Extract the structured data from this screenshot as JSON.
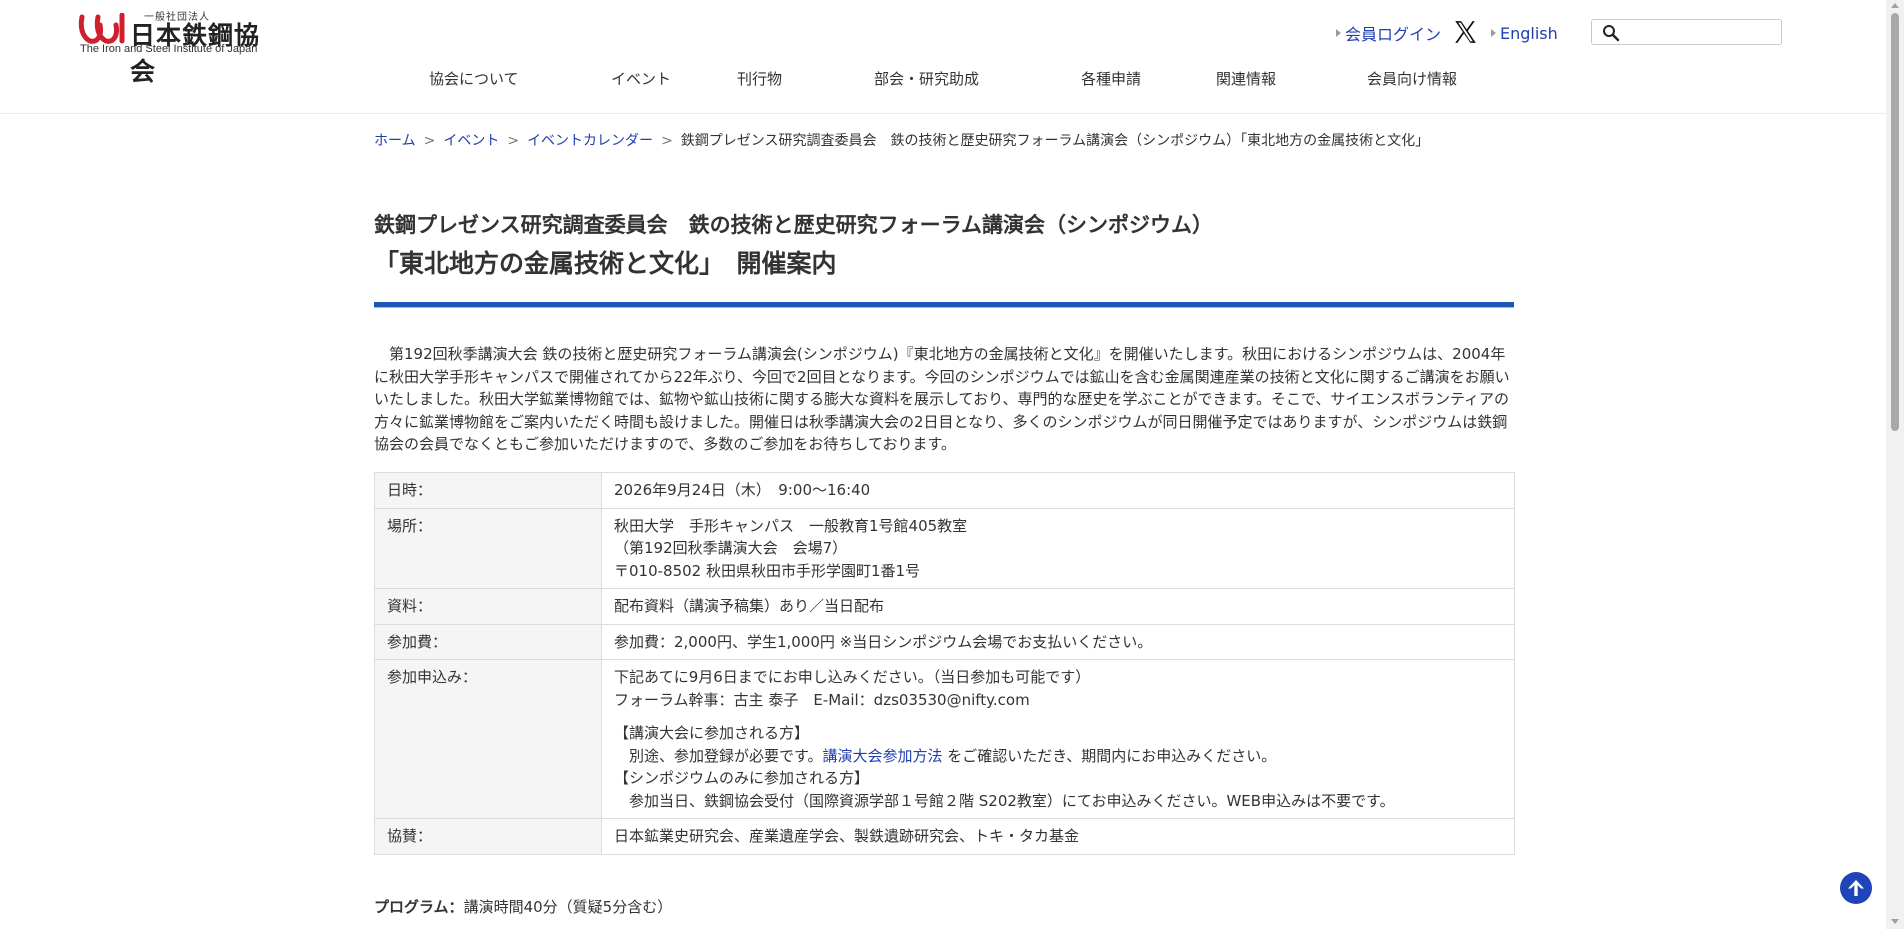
{
  "header": {
    "logo": {
      "small_text": "一般社団法人",
      "name": "日本鉄鋼協会",
      "english": "The Iron and Steel Institute of Japan",
      "mark_color": "#d0202e"
    },
    "util": {
      "login_label": "会員ログイン",
      "x_icon": "x-logo-icon",
      "english_label": "English"
    },
    "search": {
      "value": "",
      "icon": "search-icon"
    },
    "nav": [
      "協会について",
      "イベント",
      "刊行物",
      "部会・研究助成",
      "各種申請",
      "関連情報",
      "会員向け情報"
    ]
  },
  "breadcrumb": {
    "links": [
      "ホーム",
      "イベント",
      "イベントカレンダー"
    ],
    "separator": ">",
    "current": "鉄鋼プレゼンス研究調査委員会　鉄の技術と歴史研究フォーラム講演会（シンポジウム）「東北地方の金属技術と文化」"
  },
  "page": {
    "title_line1": "鉄鋼プレゼンス研究調査委員会　鉄の技術と歴史研究フォーラム講演会（シンポジウム）",
    "title_line2": "「東北地方の金属技術と文化」　開催案内",
    "accent_color": "#1d56b5",
    "intro": "第192回秋季講演大会 鉄の技術と歴史研究フォーラム講演会(シンポジウム)『東北地方の金属技術と文化』を開催いたします。秋田におけるシンポジウムは、2004年に秋田大学手形キャンパスで開催されてから22年ぶり、今回で2回目となります。今回のシンポジウムでは鉱山を含む金属関連産業の技術と文化に関するご講演をお願いいたしました。秋田大学鉱業博物館では、鉱物や鉱山技術に関する膨大な資料を展示しており、専門的な歴史を学ぶことができます。そこで、サイエンスボランティアの方々に鉱業博物館をご案内いただく時間も設けました。開催日は秋季講演大会の2日目となり、多くのシンポジウムが同日開催予定ではありますが、シンポジウムは鉄鋼協会の会員でなくともご参加いただけますので、多数のご参加をお待ちしております。"
  },
  "info": {
    "date": {
      "label": "日時：",
      "value": "2026年9月24日（木）　9:00〜16:40"
    },
    "place": {
      "label": "場所：",
      "lines": [
        "秋田大学　手形キャンパス　一般教育1号館405教室",
        "（第192回秋季講演大会　会場7）",
        "〒010-8502 秋田県秋田市手形学園町1番1号"
      ]
    },
    "material": {
      "label": "資料：",
      "value": "配布資料（講演予稿集）あり／当日配布"
    },
    "fee": {
      "label": "参加費：",
      "value": "参加費：2,000円、学生1,000円 ※当日シンポジウム会場でお支払いください。"
    },
    "apply": {
      "label": "参加申込み：",
      "line1": "下記あてに9月6日までにお申し込みください。（当日参加も可能です）",
      "line2": "フォーラム幹事：古主 泰子　E-Mail：dzs03530@nifty.com",
      "conf_head": "【講演大会に参加される方】",
      "conf_pre": "　別途、参加登録が必要です。",
      "conf_link": "講演大会参加方法",
      "conf_post": " をご確認いただき、期間内にお申込みください。",
      "sym_head": "【シンポジウムのみに参加される方】",
      "sym_body": "　参加当日、鉄鋼協会受付（国際資源学部１号館２階 S202教室）にてお申込みください。WEB申込みは不要です。"
    },
    "sponsor": {
      "label": "協賛：",
      "value": "日本鉱業史研究会、産業遺産学会、製鉄遺跡研究会、トキ・タカ基金"
    }
  },
  "program": {
    "label": "プログラム：",
    "note": "講演時間40分（質疑5分含む）"
  },
  "to_top_icon": "arrow-up-circle-icon"
}
